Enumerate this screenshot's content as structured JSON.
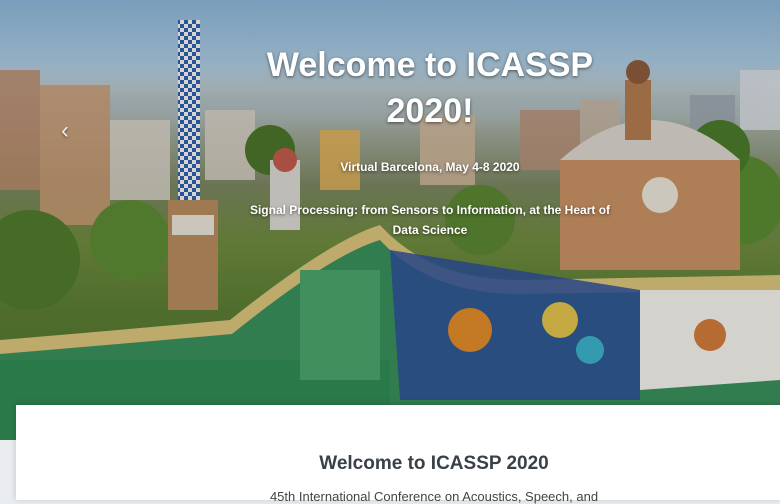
{
  "hero": {
    "title": "Welcome to ICASSP 2020!",
    "subtitle": "Virtual Barcelona, May 4-8 2020",
    "tagline": "Signal Processing: from Sensors to Information, at the Heart of Data Science",
    "prev_icon": "chevron-left-icon"
  },
  "card": {
    "title": "Welcome to ICASSP 2020",
    "text": "45th International Conference on Acoustics, Speech, and"
  },
  "colors": {
    "sky": "#8ab4d6",
    "greenery": "#5b7d33",
    "mosaic_blue": "#2f5fa8",
    "mosaic_green": "#3c9a5f",
    "mosaic_orange": "#e08a2a",
    "title_text": "#3a4048"
  }
}
